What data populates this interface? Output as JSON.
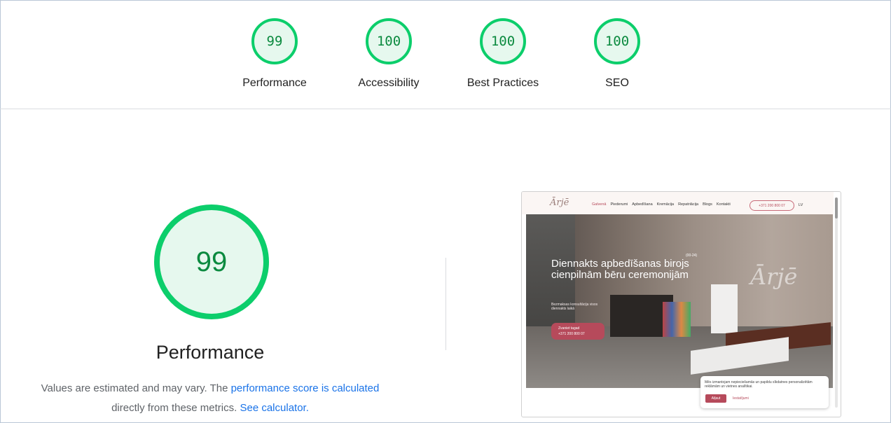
{
  "top_scores": [
    {
      "score": "99",
      "label": "Performance"
    },
    {
      "score": "100",
      "label": "Accessibility"
    },
    {
      "score": "100",
      "label": "Best Practices"
    },
    {
      "score": "100",
      "label": "SEO"
    }
  ],
  "performance": {
    "score": "99",
    "title": "Performance",
    "note_prefix": "Values are estimated and may vary. The ",
    "note_link": "performance score is calculated",
    "note_middle": "directly from these metrics.",
    "note_link2": "See calculator."
  },
  "colors": {
    "pass": "#0cce6b",
    "pass_bg": "#e6f8ee",
    "link": "#1a73e8",
    "brand": "#b64a5b"
  },
  "screenshot": {
    "nav": [
      "Galvenā",
      "Piederumi",
      "Apbedīšana",
      "Kremācija",
      "Repatriācija",
      "Blogs",
      "Kontakti"
    ],
    "phone": "+371 200 800 07",
    "lang": "LV",
    "hero_title": "Diennakts apbedīšanas birojs cienpilnām bēru ceremonijām",
    "hero_badge": "(00-24)",
    "hero_sub": "Bezmaksas konsultācija visos diennakts laikā",
    "cta_line1": "Zvaniet tagad",
    "cta_line2": "+371 200 800 07",
    "cookie_text": "Mēs izmantojam nepieciešamās un papildu sīkdatnes personalizētām reklāmām un vietnes analītikai.",
    "cookie_accept": "Atļaut",
    "cookie_settings": "Iestatījumi"
  }
}
